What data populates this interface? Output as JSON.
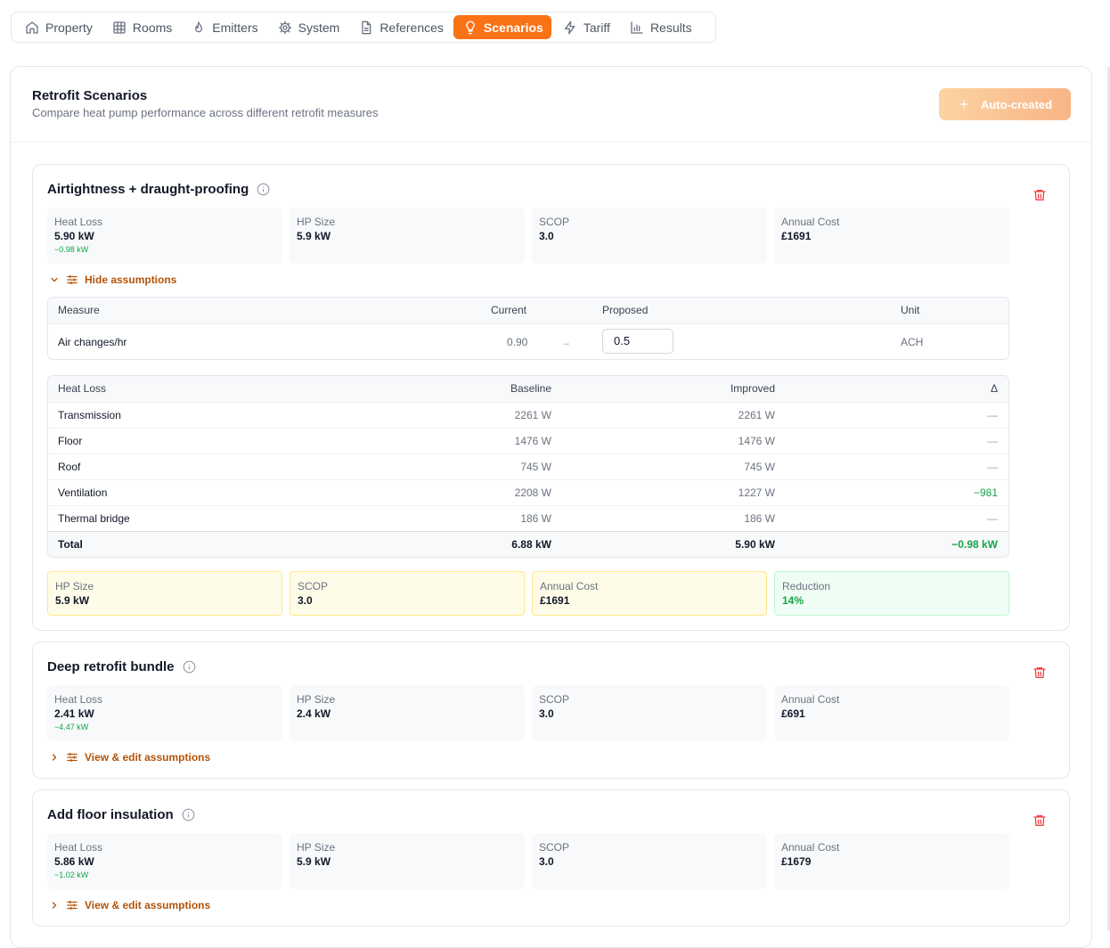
{
  "nav": {
    "tabs": [
      {
        "label": "Property",
        "icon": "home-icon",
        "active": false
      },
      {
        "label": "Rooms",
        "icon": "grid-icon",
        "active": false
      },
      {
        "label": "Emitters",
        "icon": "flame-icon",
        "active": false
      },
      {
        "label": "System",
        "icon": "gear-icon",
        "active": false
      },
      {
        "label": "References",
        "icon": "document-icon",
        "active": false
      },
      {
        "label": "Scenarios",
        "icon": "lightbulb-icon",
        "active": true
      },
      {
        "label": "Tariff",
        "icon": "lightning-icon",
        "active": false
      },
      {
        "label": "Results",
        "icon": "bar-chart-icon",
        "active": false
      }
    ]
  },
  "header": {
    "title": "Retrofit Scenarios",
    "subtitle": "Compare heat pump performance across different retrofit measures",
    "auto_button": "Auto-created"
  },
  "scenarios": [
    {
      "title": "Airtightness + draught-proofing",
      "metrics": {
        "heat_loss_label": "Heat Loss",
        "heat_loss": "5.90 kW",
        "heat_loss_delta": "−0.98 kW",
        "hp_label": "HP Size",
        "hp": "5.9 kW",
        "scop_label": "SCOP",
        "scop": "3.0",
        "cost_label": "Annual Cost",
        "cost": "£1691"
      },
      "toggle": "Hide assumptions",
      "measures": {
        "headers": {
          "measure": "Measure",
          "current": "Current",
          "proposed": "Proposed",
          "unit": "Unit"
        },
        "row": {
          "measure": "Air changes/hr",
          "current": "0.90",
          "arrow": "→",
          "proposed": "0.5",
          "unit": "ACH"
        }
      },
      "heat_loss_table": {
        "headers": {
          "label": "Heat Loss",
          "baseline": "Baseline",
          "improved": "Improved",
          "delta": "Δ"
        },
        "rows": [
          {
            "label": "Transmission",
            "baseline": "2261 W",
            "improved": "2261 W",
            "delta": "—"
          },
          {
            "label": "Floor",
            "baseline": "1476 W",
            "improved": "1476 W",
            "delta": "—"
          },
          {
            "label": "Roof",
            "baseline": "745 W",
            "improved": "745 W",
            "delta": "—"
          },
          {
            "label": "Ventilation",
            "baseline": "2208 W",
            "improved": "1227 W",
            "delta": "−981"
          },
          {
            "label": "Thermal bridge",
            "baseline": "186 W",
            "improved": "186 W",
            "delta": "—"
          }
        ],
        "total": {
          "label": "Total",
          "baseline": "6.88 kW",
          "improved": "5.90 kW",
          "delta": "−0.98 kW"
        }
      },
      "summary": {
        "hp_label": "HP Size",
        "hp": "5.9 kW",
        "scop_label": "SCOP",
        "scop": "3.0",
        "cost_label": "Annual Cost",
        "cost": "£1691",
        "reduction_label": "Reduction",
        "reduction": "14%"
      }
    },
    {
      "title": "Deep retrofit bundle",
      "metrics": {
        "heat_loss_label": "Heat Loss",
        "heat_loss": "2.41 kW",
        "heat_loss_delta": "−4.47 kW",
        "hp_label": "HP Size",
        "hp": "2.4 kW",
        "scop_label": "SCOP",
        "scop": "3.0",
        "cost_label": "Annual Cost",
        "cost": "£691"
      },
      "toggle": "View & edit assumptions"
    },
    {
      "title": "Add floor insulation",
      "metrics": {
        "heat_loss_label": "Heat Loss",
        "heat_loss": "5.86 kW",
        "heat_loss_delta": "−1.02 kW",
        "hp_label": "HP Size",
        "hp": "5.9 kW",
        "scop_label": "SCOP",
        "scop": "3.0",
        "cost_label": "Annual Cost",
        "cost": "£1679"
      },
      "toggle": "View & edit assumptions"
    }
  ],
  "colors": {
    "accent": "#f97316",
    "delete": "#ef4444",
    "positive": "#16a34a",
    "link": "#b45309"
  }
}
